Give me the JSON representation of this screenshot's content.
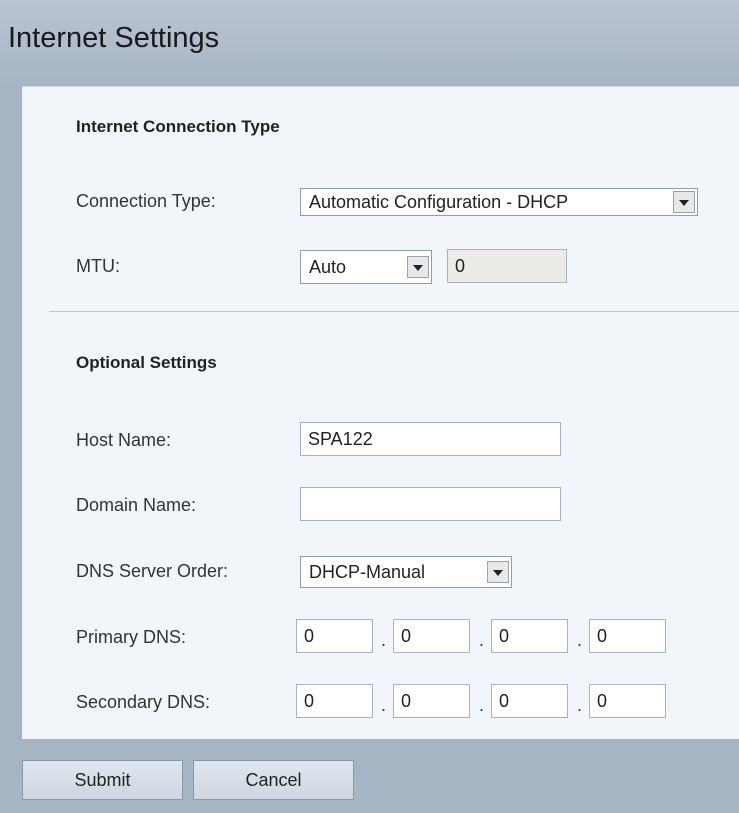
{
  "header": {
    "title": "Internet Settings"
  },
  "connection": {
    "section_title": "Internet Connection Type",
    "type_label": "Connection Type:",
    "type_value": "Automatic Configuration - DHCP",
    "mtu_label": "MTU:",
    "mtu_mode": "Auto",
    "mtu_value": "0"
  },
  "optional": {
    "section_title": "Optional Settings",
    "host_label": "Host Name:",
    "host_value": "SPA122",
    "domain_label": "Domain Name:",
    "domain_value": "",
    "dns_order_label": "DNS Server Order:",
    "dns_order_value": "DHCP-Manual",
    "primary_label": "Primary DNS:",
    "primary": [
      "0",
      "0",
      "0",
      "0"
    ],
    "secondary_label": "Secondary DNS:",
    "secondary": [
      "0",
      "0",
      "0",
      "0"
    ],
    "separator": "."
  },
  "actions": {
    "submit": "Submit",
    "cancel": "Cancel"
  }
}
